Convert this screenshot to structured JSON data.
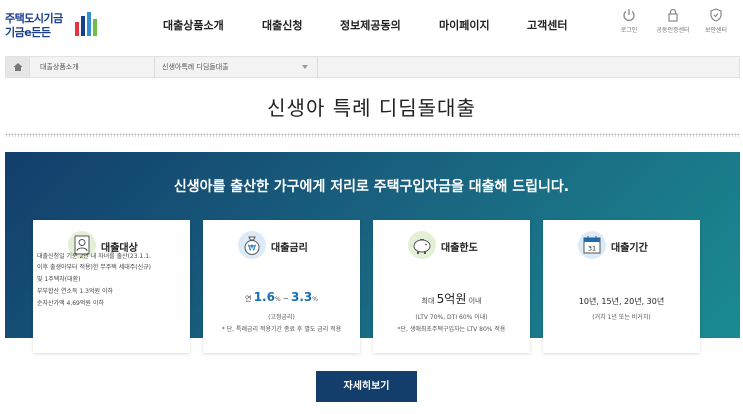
{
  "header": {
    "logo_line1": "주택도시기금",
    "logo_line2": "기금e든든",
    "nav": [
      "대출상품소개",
      "대출신청",
      "정보제공동의",
      "마이페이지",
      "고객센터"
    ],
    "util": [
      "로그인",
      "공동인증센터",
      "보안센터"
    ]
  },
  "breadcrumb": {
    "level1": "대출상품소개",
    "level2": "신생아특례 디딤돌대출"
  },
  "page_title": "신생아 특례 디딤돌대출",
  "banner_title": "신생아를 출산한 가구에게 저리로 주택구입자금을 대출해 드립니다.",
  "cards": {
    "target": {
      "heading": "대출대상",
      "lines": [
        "대출신청일 기준 2년 내 자녀를 출산(23.1.1.",
        "이후 출생아부터 적용)한 무주택 세대주(신규)",
        "및 1주택자(대환)",
        "부부합산 연소득 1.3억원 이하",
        "순자산가액 4.69억원 이하"
      ]
    },
    "rate": {
      "heading": "대출금리",
      "prefix": "연",
      "low": "1.6",
      "pct1": "%",
      "tilde": "~",
      "high": "3.3",
      "pct2": "%",
      "note1": "(고정금리)",
      "note2": "* 단, 특례금리 적용기간 종료 후 별도 금리 적용"
    },
    "limit": {
      "heading": "대출한도",
      "prefix": "최대",
      "amount": "5억원",
      "suffix": "이내",
      "note1": "(LTV 70%, DTI 60% 이내)",
      "note2": "*단, 생애최초주택구입자는 LTV 80% 적용"
    },
    "period": {
      "heading": "대출기간",
      "calendar_day": "31",
      "value": "10년, 15년, 20년, 30년",
      "note": "(거치 1년 또는 비거치)"
    }
  },
  "detail_button": "자세히보기",
  "colors": {
    "brand_navy": "#133d6a",
    "banner_start": "#123e6b",
    "banner_end": "#1a8b92",
    "rate_blue": "#1a6fb4"
  }
}
